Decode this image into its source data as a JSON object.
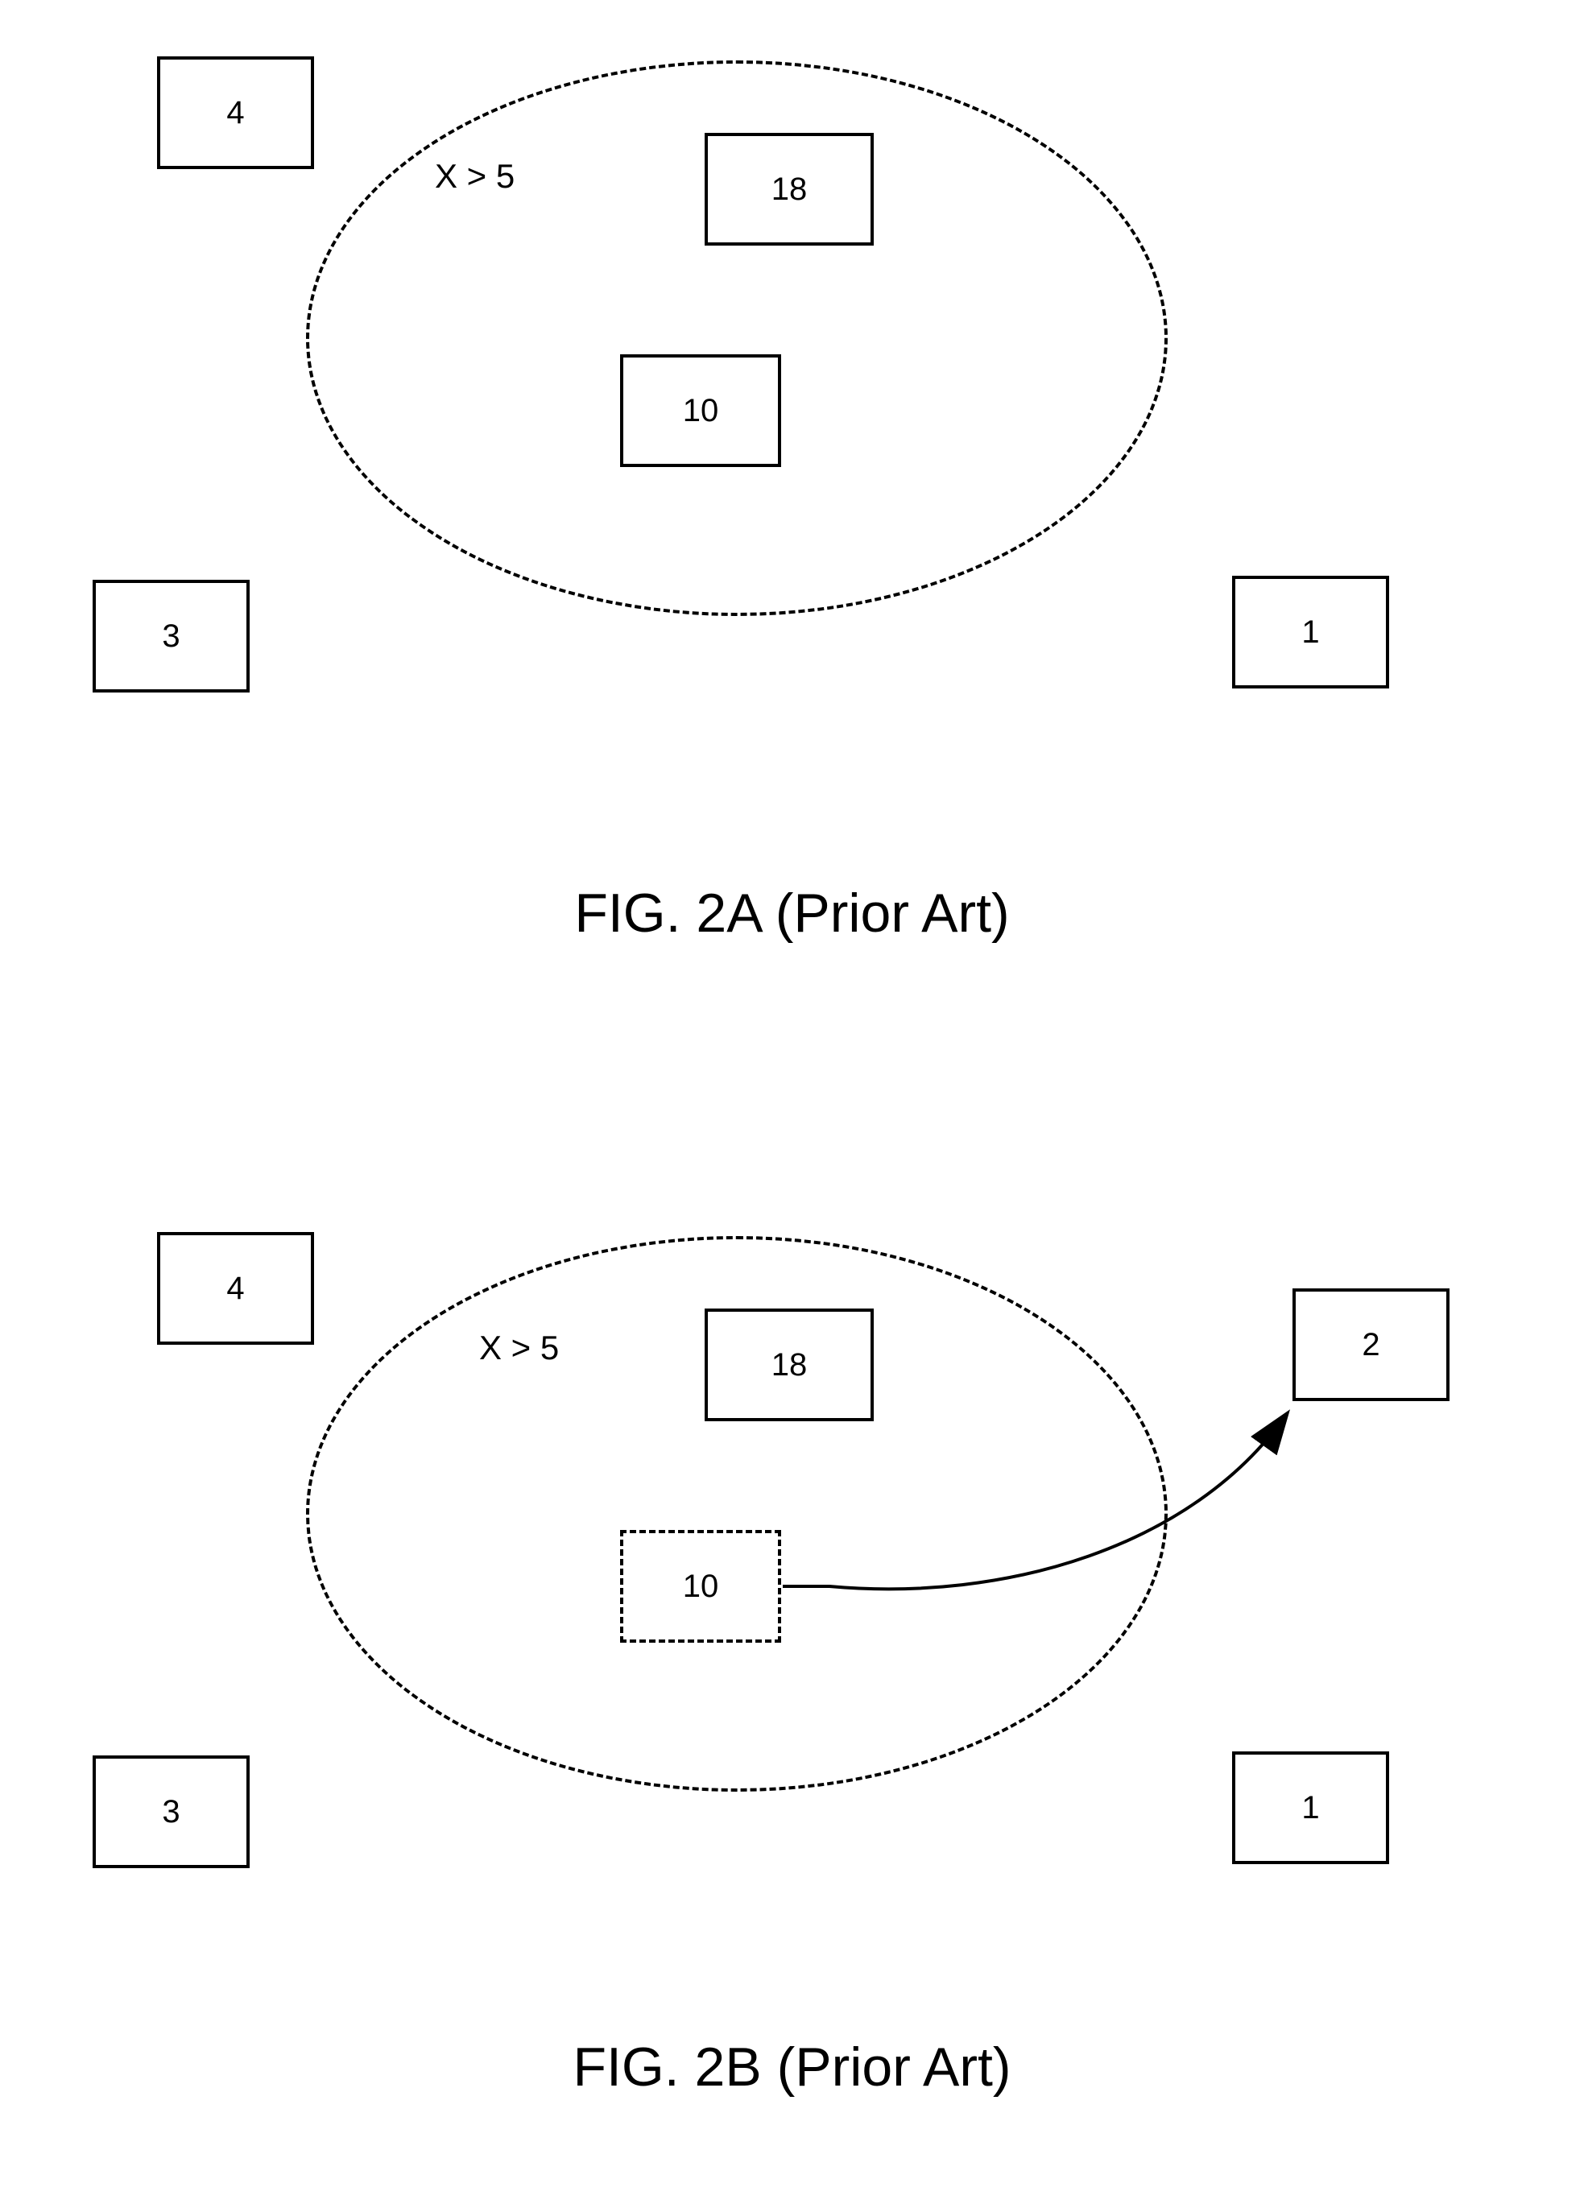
{
  "figA": {
    "ellipse_label": "X > 5",
    "caption": "FIG. 2A (Prior Art)",
    "boxes": {
      "b4": "4",
      "b18": "18",
      "b10": "10",
      "b3": "3",
      "b1": "1"
    }
  },
  "figB": {
    "ellipse_label": "X > 5",
    "caption": "FIG. 2B (Prior Art)",
    "boxes": {
      "b4": "4",
      "b18": "18",
      "b10": "10",
      "b3": "3",
      "b1": "1",
      "b2": "2"
    }
  }
}
